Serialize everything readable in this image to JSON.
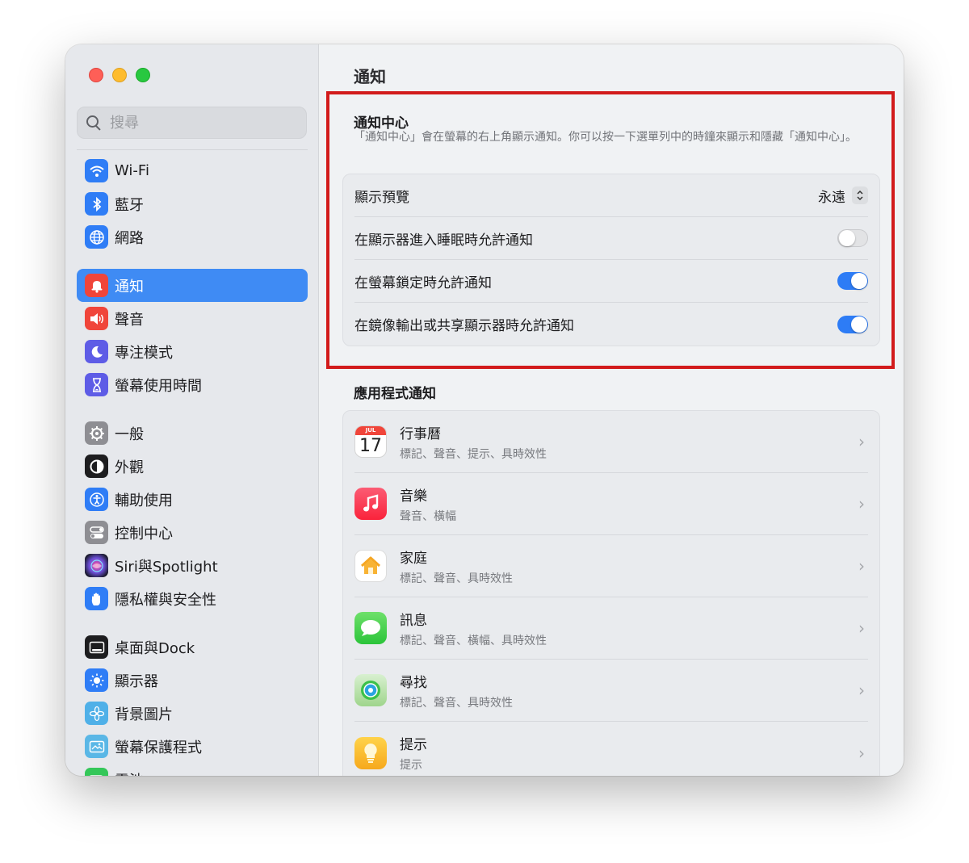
{
  "colors": {
    "accent": "#3f8bf4",
    "toggle_on": "#2d7cf6",
    "highlight_border": "#d21b1b"
  },
  "sidebar": {
    "search": {
      "placeholder": "搜尋"
    },
    "items": [
      {
        "label": "Wi-Fi",
        "icon": "wifi-icon",
        "color": "#2f7df6"
      },
      {
        "label": "藍牙",
        "icon": "bluetooth-icon",
        "color": "#2f7df6"
      },
      {
        "label": "網路",
        "icon": "globe-icon",
        "color": "#2f7df6"
      },
      {
        "label": "通知",
        "icon": "bell-icon",
        "color": "#f0453a",
        "active": true
      },
      {
        "label": "聲音",
        "icon": "speaker-icon",
        "color": "#f0453a"
      },
      {
        "label": "專注模式",
        "icon": "moon-icon",
        "color": "#5e5ce6"
      },
      {
        "label": "螢幕使用時間",
        "icon": "hourglass-icon",
        "color": "#5e5ce6"
      },
      {
        "label": "一般",
        "icon": "gear-icon",
        "color": "#8e8e93"
      },
      {
        "label": "外觀",
        "icon": "appearance-icon",
        "color": "#1d1d1f"
      },
      {
        "label": "輔助使用",
        "icon": "accessibility-icon",
        "color": "#2f7df6"
      },
      {
        "label": "控制中心",
        "icon": "control-center-icon",
        "color": "#8e8e93"
      },
      {
        "label": "Siri與Spotlight",
        "icon": "siri-icon",
        "color": "#6b4fd8"
      },
      {
        "label": "隱私權與安全性",
        "icon": "hand-icon",
        "color": "#2f7df6"
      },
      {
        "label": "桌面與Dock",
        "icon": "dock-icon",
        "color": "#1d1d1f"
      },
      {
        "label": "顯示器",
        "icon": "sun-icon",
        "color": "#2f7df6"
      },
      {
        "label": "背景圖片",
        "icon": "flower-icon",
        "color": "#4fb0e8"
      },
      {
        "label": "螢幕保護程式",
        "icon": "screensaver-icon",
        "color": "#5ab7e6"
      },
      {
        "label": "電池",
        "icon": "battery-icon",
        "color": "#34c759"
      }
    ]
  },
  "main": {
    "title": "通知",
    "notification_center": {
      "heading": "通知中心",
      "description": "「通知中心」會在螢幕的右上角顯示通知。你可以按一下選單列中的時鐘來顯示和隱藏「通知中心」。",
      "show_preview": {
        "label": "顯示預覽",
        "value": "永遠"
      },
      "toggles": [
        {
          "label": "在顯示器進入睡眠時允許通知",
          "on": false
        },
        {
          "label": "在螢幕鎖定時允許通知",
          "on": true
        },
        {
          "label": "在鏡像輸出或共享顯示器時允許通知",
          "on": true
        }
      ]
    },
    "app_notifications": {
      "heading": "應用程式通知",
      "apps": [
        {
          "name": "行事曆",
          "sub": "標記、聲音、提示、具時效性",
          "icon": "calendar-icon",
          "cal_month": "JUL",
          "cal_day": "17"
        },
        {
          "name": "音樂",
          "sub": "聲音、橫幅",
          "icon": "music-icon"
        },
        {
          "name": "家庭",
          "sub": "標記、聲音、具時效性",
          "icon": "home-icon"
        },
        {
          "name": "訊息",
          "sub": "標記、聲音、橫幅、具時效性",
          "icon": "messages-icon"
        },
        {
          "name": "尋找",
          "sub": "標記、聲音、具時效性",
          "icon": "find-my-icon"
        },
        {
          "name": "提示",
          "sub": "提示",
          "icon": "tips-icon"
        }
      ]
    }
  }
}
